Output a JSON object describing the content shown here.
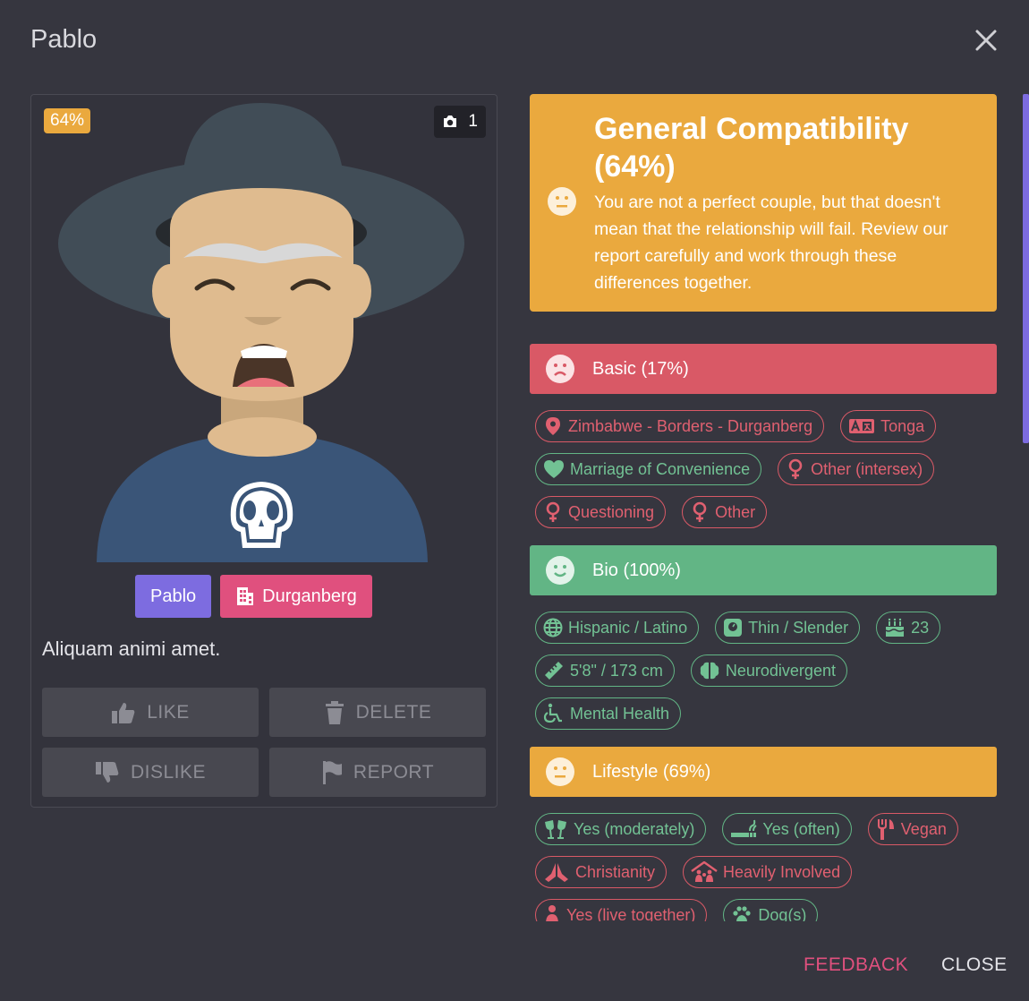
{
  "dialog": {
    "title": "Pablo"
  },
  "profile": {
    "match_badge": "64%",
    "photo_count": "1",
    "name_chip": "Pablo",
    "city_chip": "Durganberg",
    "bio": "Aliquam animi amet.",
    "actions": {
      "like": "LIKE",
      "delete": "DELETE",
      "dislike": "DISLIKE",
      "report": "REPORT"
    }
  },
  "general": {
    "title": "General Compatibility (64%)",
    "text": "You are not a perfect couple, but that doesn't mean that the relationship will fail. Review our report carefully and work through these differences together."
  },
  "sections": {
    "basic": {
      "title": "Basic (17%)",
      "tags": [
        "Zimbabwe - Borders - Durganberg",
        "Tonga",
        "Marriage of Convenience",
        "Other (intersex)",
        "Questioning",
        "Other"
      ]
    },
    "bio": {
      "title": "Bio (100%)",
      "tags": [
        "Hispanic / Latino",
        "Thin / Slender",
        "23",
        "5'8\" / 173 cm",
        "Neurodivergent",
        "Mental Health"
      ]
    },
    "lifestyle": {
      "title": "Lifestyle (69%)",
      "tags": [
        "Yes (moderately)",
        "Yes (often)",
        "Vegan",
        "Christianity",
        "Heavily Involved",
        "Yes (live together)",
        "Dog(s)"
      ]
    }
  },
  "footer": {
    "feedback": "FEEDBACK",
    "close": "CLOSE"
  },
  "colors": {
    "accent_purple": "#7d6ce0",
    "pink": "#e0507e",
    "yellow": "#eaa93e",
    "red": "#d95966",
    "green": "#62b585"
  }
}
